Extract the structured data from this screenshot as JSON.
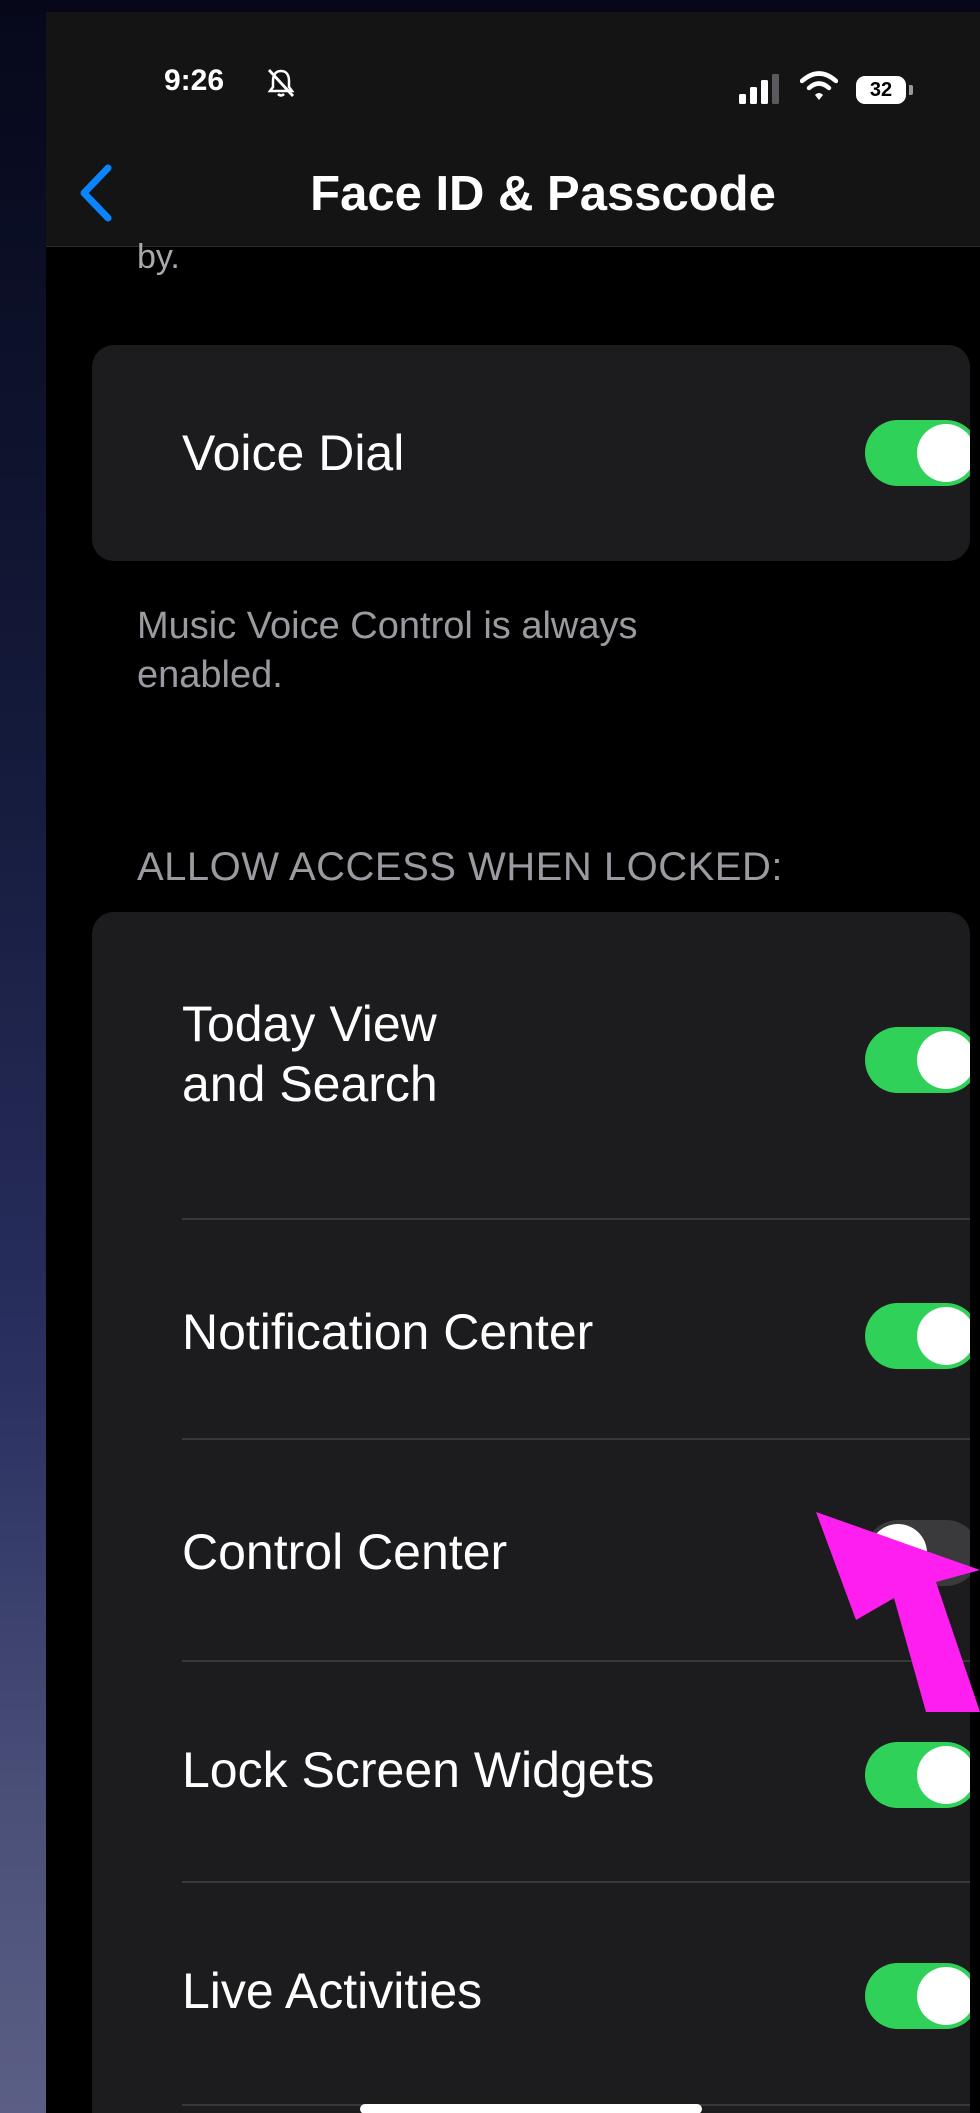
{
  "status_bar": {
    "time": "9:26",
    "battery": "32"
  },
  "nav": {
    "title": "Face ID & Passcode"
  },
  "truncated_text": "by.",
  "voice_group": {
    "voice_dial": {
      "label": "Voice Dial",
      "on": true
    }
  },
  "voice_footer": "Music Voice Control is always enabled.",
  "locked_section": {
    "header": "ALLOW ACCESS WHEN LOCKED:",
    "items": [
      {
        "label": "Today View\nand Search",
        "on": true
      },
      {
        "label": "Notification Center",
        "on": true
      },
      {
        "label": "Control Center",
        "on": false
      },
      {
        "label": "Lock Screen Widgets",
        "on": true
      },
      {
        "label": "Live Activities",
        "on": true
      }
    ]
  },
  "colors": {
    "toggle_on": "#30d158",
    "accent": "#0a84ff",
    "annotation_arrow": "#ff1ef0"
  },
  "icons": [
    "bell-slash-icon",
    "cellular-signal-icon",
    "wifi-icon",
    "battery-icon",
    "back-chevron-icon",
    "annotation-arrow"
  ]
}
